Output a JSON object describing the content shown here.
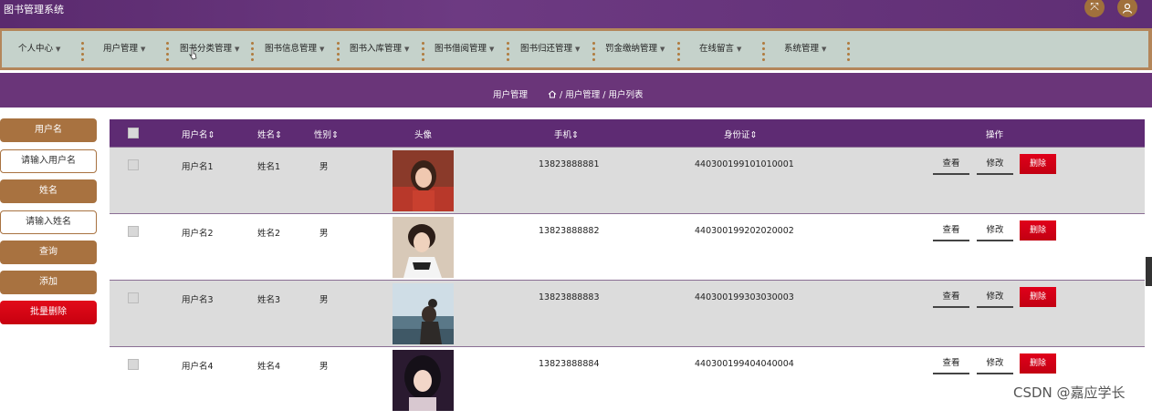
{
  "app": {
    "title": "图书管理系统"
  },
  "header_icons": [
    "fullscreen-icon",
    "user-icon"
  ],
  "menu": [
    {
      "label": "个人中心"
    },
    {
      "label": "用户管理"
    },
    {
      "label": "图书分类管理"
    },
    {
      "label": "图书信息管理"
    },
    {
      "label": "图书入库管理"
    },
    {
      "label": "图书借阅管理"
    },
    {
      "label": "图书归还管理"
    },
    {
      "label": "罚金缴纳管理"
    },
    {
      "label": "在线留言"
    },
    {
      "label": "系统管理"
    }
  ],
  "page": {
    "title": "用户管理",
    "breadcrumb": "/ 用户管理 / 用户列表"
  },
  "sidebar": {
    "username_label": "用户名",
    "username_placeholder": "请输入用户名",
    "name_label": "姓名",
    "name_placeholder": "请输入姓名",
    "query": "查询",
    "add": "添加",
    "batch_delete": "批量删除"
  },
  "table": {
    "headers": {
      "username": "用户名",
      "name": "姓名",
      "gender": "性别",
      "avatar": "头像",
      "phone": "手机",
      "id_card": "身份证",
      "actions": "操作"
    },
    "sort_glyph": "⇕",
    "rows": [
      {
        "username": "用户名1",
        "name": "姓名1",
        "gender": "男",
        "phone": "13823888881",
        "id_card": "440300199101010001"
      },
      {
        "username": "用户名2",
        "name": "姓名2",
        "gender": "男",
        "phone": "13823888882",
        "id_card": "440300199202020002"
      },
      {
        "username": "用户名3",
        "name": "姓名3",
        "gender": "男",
        "phone": "13823888883",
        "id_card": "440300199303030003"
      },
      {
        "username": "用户名4",
        "name": "姓名4",
        "gender": "男",
        "phone": "13823888884",
        "id_card": "440300199404040004"
      }
    ],
    "actions": {
      "view": "查看",
      "edit": "修改",
      "delete": "删除"
    }
  },
  "watermark": "CSDN @嘉应学长",
  "colors": {
    "header_purple": "#5e2b73",
    "accent_brown": "#a87240",
    "delete_red": "#d0001a",
    "menu_bg": "#c5d2cb"
  }
}
